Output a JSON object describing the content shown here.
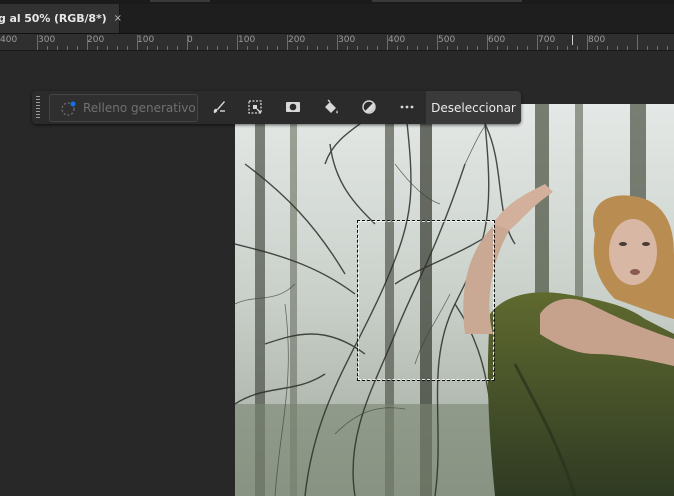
{
  "document_tab": {
    "title": "g al 50% (RGB/8*)",
    "close_glyph": "×"
  },
  "ruler": {
    "labels": [
      "400",
      "300",
      "200",
      "100",
      "0",
      "100",
      "200",
      "300",
      "400",
      "500",
      "600",
      "700",
      "800"
    ]
  },
  "taskbar": {
    "generative_fill_label": "Relleno generativo",
    "tools": [
      {
        "icon": "brush-icon"
      },
      {
        "icon": "transform-selection-icon"
      },
      {
        "icon": "mask-icon"
      },
      {
        "icon": "fill-bucket-icon"
      },
      {
        "icon": "adjustment-icon"
      },
      {
        "icon": "more-icon"
      }
    ],
    "deselect_label": "Deseleccionar"
  },
  "colors": {
    "workspace": "#282828",
    "taskbar": "#2b2b2b",
    "accent": "#1473e6"
  }
}
